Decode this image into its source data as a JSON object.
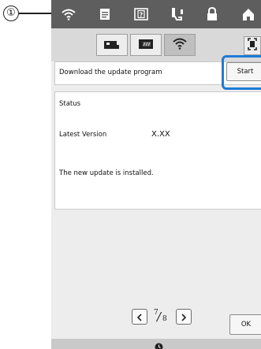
{
  "callout": {
    "number": "①"
  },
  "top_bar": {
    "icons": [
      "wifi-icon",
      "document-icon",
      "help-icon",
      "sewing-needle-icon",
      "lock-icon",
      "home-icon"
    ]
  },
  "sub_tabs": {
    "icons": [
      "machine-icon",
      "card-icon",
      "wifi-icon",
      "resize-icon"
    ],
    "active": "wifi-icon"
  },
  "update": {
    "label": "Download the update program",
    "start_button": "Start"
  },
  "status": {
    "heading": "Status",
    "version_label": "Latest Version",
    "version_value": "X.XX",
    "message": "The new update is installed."
  },
  "pager": {
    "current": "7",
    "total": "8"
  },
  "ok_button": "OK",
  "colors": {
    "top_bar": "#5e5e5e",
    "highlight": "#1d7bd8",
    "screen_bg": "#ededed"
  }
}
